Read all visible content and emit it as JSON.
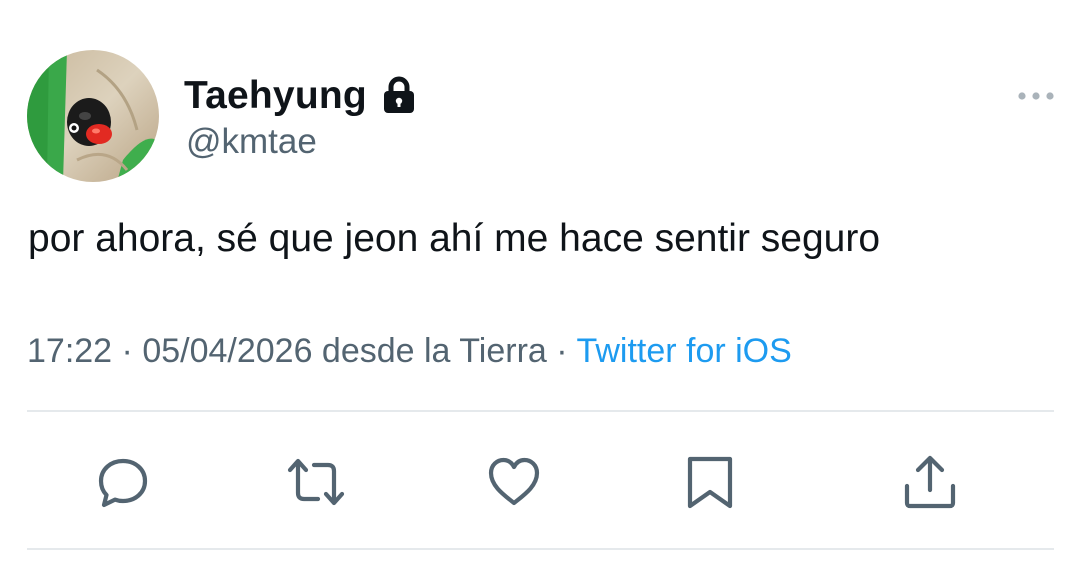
{
  "tweet": {
    "author": {
      "display_name": "Taehyung",
      "handle": "@kmtae",
      "protected": true
    },
    "text": "por ahora, sé que jeon ahí me hace sentir seguro",
    "meta": {
      "time": "17:22",
      "separator1": " · ",
      "date_location": "05/04/2026 desde la Tierra",
      "separator2": " · ",
      "source": "Twitter for iOS"
    }
  },
  "actions": [
    {
      "name": "reply",
      "icon": "reply-icon"
    },
    {
      "name": "retweet",
      "icon": "retweet-icon"
    },
    {
      "name": "like",
      "icon": "heart-icon"
    },
    {
      "name": "bookmark",
      "icon": "bookmark-icon"
    },
    {
      "name": "share",
      "icon": "share-icon"
    }
  ],
  "colors": {
    "text_primary": "#0f1419",
    "text_secondary": "#536471",
    "link": "#1d9bf0",
    "divider": "#e5e9ec"
  }
}
